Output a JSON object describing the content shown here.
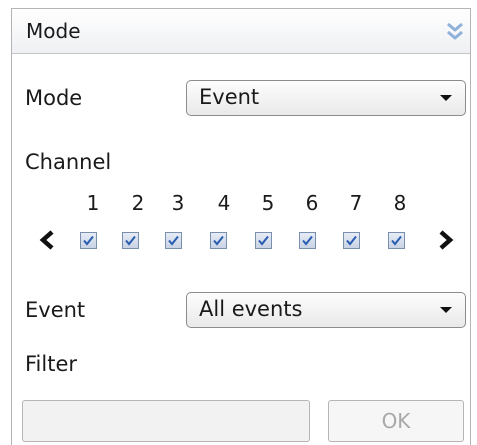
{
  "header": {
    "title": "Mode",
    "collapse_icon": "double-chevron-down-icon"
  },
  "mode": {
    "label": "Mode",
    "selected": "Event"
  },
  "channel": {
    "label": "Channel",
    "items": [
      {
        "number": "1",
        "checked": true
      },
      {
        "number": "2",
        "checked": true
      },
      {
        "number": "3",
        "checked": true
      },
      {
        "number": "4",
        "checked": true
      },
      {
        "number": "5",
        "checked": true
      },
      {
        "number": "6",
        "checked": true
      },
      {
        "number": "7",
        "checked": true
      },
      {
        "number": "8",
        "checked": true
      }
    ],
    "prev_icon": "chevron-left-icon",
    "next_icon": "chevron-right-icon"
  },
  "event": {
    "label": "Event",
    "selected": "All events"
  },
  "filter": {
    "label": "Filter",
    "value": "",
    "ok_label": "OK"
  },
  "colors": {
    "accent": "#7fa6d8",
    "check": "#2a5db0",
    "disabled_text": "#a8a8a8"
  }
}
